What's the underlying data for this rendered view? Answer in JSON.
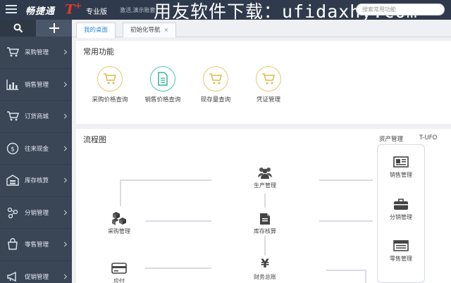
{
  "topbar": {
    "brand": "畅捷通",
    "logo": "T",
    "logo_plus": "+",
    "edition": "专业版",
    "company": "激活,演示账套",
    "watermark": "用友软件下载：ufidaxhy.com",
    "search_placeholder": "搜索常用功能"
  },
  "sidebar": {
    "items": [
      {
        "label": "采购管理",
        "icon": "cart-icon"
      },
      {
        "label": "销售管理",
        "icon": "bar-chart-icon"
      },
      {
        "label": "订货商城",
        "icon": "shop-cart-icon"
      },
      {
        "label": "往来现金",
        "icon": "yuan-circle-icon"
      },
      {
        "label": "库存核算",
        "icon": "warehouse-icon"
      },
      {
        "label": "分销管理",
        "icon": "network-icon"
      },
      {
        "label": "零售管理",
        "icon": "bag-icon"
      },
      {
        "label": "促销管理",
        "icon": "megaphone-icon"
      }
    ]
  },
  "tabs": [
    {
      "label": "我的桌面",
      "active": true
    },
    {
      "label": "初始化导航",
      "close": "×"
    }
  ],
  "common": {
    "title": "常用功能",
    "items": [
      {
        "label": "采购价格查询",
        "icon": "cart-icon"
      },
      {
        "label": "销售价格查询",
        "icon": "document-icon"
      },
      {
        "label": "现存量查询",
        "icon": "cart-icon"
      },
      {
        "label": "凭证管理",
        "icon": "cart-icon"
      }
    ]
  },
  "flow": {
    "title": "流程图",
    "links": [
      "资产管理",
      "T-UFO"
    ],
    "nodes": {
      "production": "生产管理",
      "purchase": "采购管理",
      "inventory": "库存核算",
      "ledger": "财务总账",
      "payable": "应付",
      "sales": "销售管理",
      "distribution": "分销管理",
      "retail": "零售管理"
    },
    "ledger_symbol": "¥"
  },
  "colors": {
    "topbar": "#2f3b4c",
    "sidebar": "#3a4556",
    "accent_blue": "#2c8fd6",
    "logo_red": "#e23a2e",
    "icon_gold": "#e7c96b",
    "icon_teal": "#46c7b3"
  }
}
